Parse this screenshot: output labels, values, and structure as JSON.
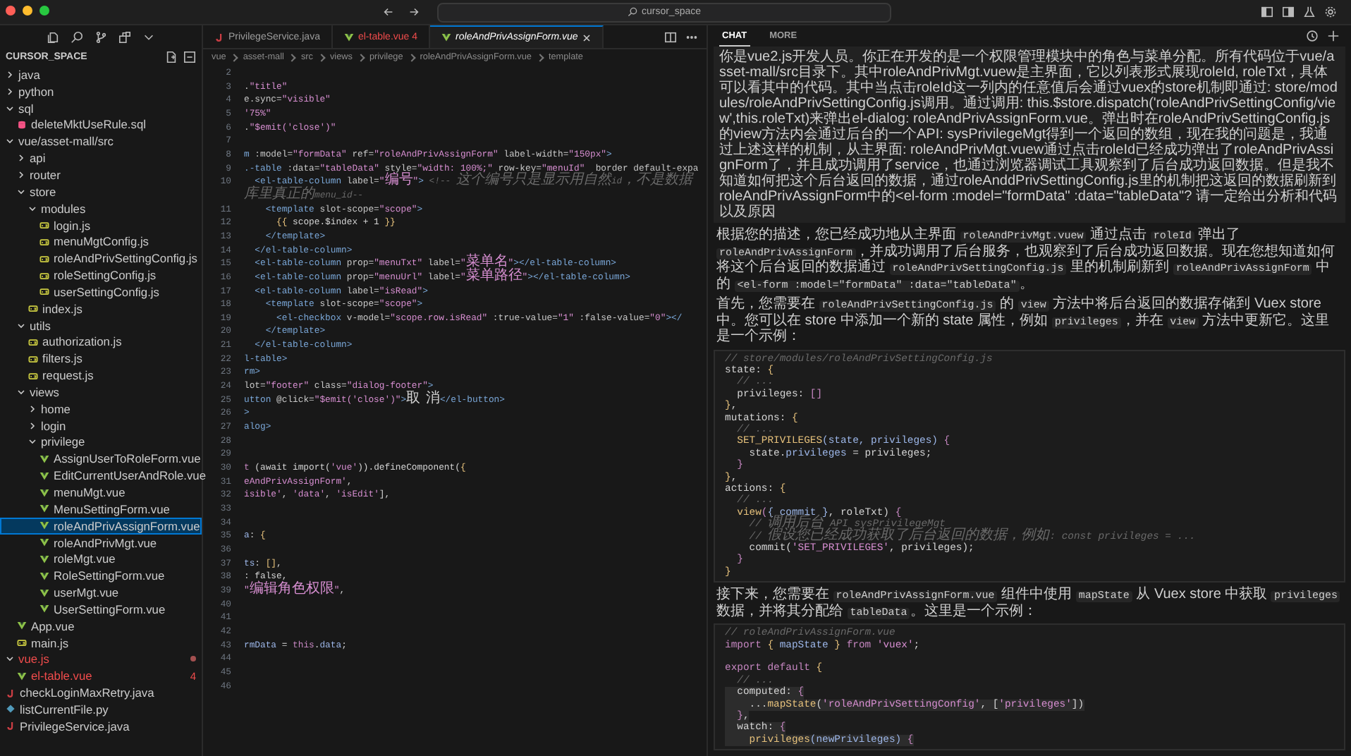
{
  "titlebar": {
    "search": "cursor_space"
  },
  "sidebar": {
    "title": "CURSOR_SPACE",
    "tree": [
      {
        "label": "java",
        "kind": "folder",
        "expanded": false,
        "selected": false,
        "error": false
      },
      {
        "label": "python",
        "kind": "folder",
        "expanded": false,
        "selected": false,
        "error": false
      },
      {
        "label": "sql",
        "kind": "folder",
        "expanded": true,
        "selected": false,
        "error": false,
        "children": [
          {
            "label": "deleteMktUseRule.sql",
            "kind": "sql",
            "selected": false,
            "error": false
          }
        ]
      },
      {
        "label": "vue/asset-mall/src",
        "kind": "folder",
        "expanded": true,
        "selected": false,
        "error": false,
        "children": [
          {
            "label": "api",
            "kind": "folder",
            "expanded": false,
            "selected": false,
            "error": false
          },
          {
            "label": "router",
            "kind": "folder",
            "expanded": false,
            "selected": false,
            "error": false
          },
          {
            "label": "store",
            "kind": "folder",
            "expanded": true,
            "selected": false,
            "error": false,
            "children": [
              {
                "label": "modules",
                "kind": "folder",
                "expanded": true,
                "selected": false,
                "error": false,
                "children": [
                  {
                    "label": "login.js",
                    "kind": "js",
                    "selected": false,
                    "error": false
                  },
                  {
                    "label": "menuMgtConfig.js",
                    "kind": "js",
                    "selected": false,
                    "error": false
                  },
                  {
                    "label": "roleAndPrivSettingConfig.js",
                    "kind": "js",
                    "selected": false,
                    "error": false
                  },
                  {
                    "label": "roleSettingConfig.js",
                    "kind": "js",
                    "selected": false,
                    "error": false
                  },
                  {
                    "label": "userSettingConfig.js",
                    "kind": "js",
                    "selected": false,
                    "error": false
                  }
                ]
              },
              {
                "label": "index.js",
                "kind": "js",
                "selected": false,
                "error": false
              }
            ]
          },
          {
            "label": "utils",
            "kind": "folder",
            "expanded": true,
            "selected": false,
            "error": false,
            "children": [
              {
                "label": "authorization.js",
                "kind": "js",
                "selected": false,
                "error": false
              },
              {
                "label": "filters.js",
                "kind": "js",
                "selected": false,
                "error": false
              },
              {
                "label": "request.js",
                "kind": "js",
                "selected": false,
                "error": false
              }
            ]
          },
          {
            "label": "views",
            "kind": "folder",
            "expanded": true,
            "selected": false,
            "error": false,
            "children": [
              {
                "label": "home",
                "kind": "folder",
                "expanded": false,
                "selected": false,
                "error": false
              },
              {
                "label": "login",
                "kind": "folder",
                "expanded": false,
                "selected": false,
                "error": false
              },
              {
                "label": "privilege",
                "kind": "folder",
                "expanded": true,
                "selected": false,
                "error": false,
                "children": [
                  {
                    "label": "AssignUserToRoleForm.vue",
                    "kind": "vue",
                    "selected": false,
                    "error": false
                  },
                  {
                    "label": "EditCurrentUserAndRole.vue",
                    "kind": "vue",
                    "selected": false,
                    "error": false
                  },
                  {
                    "label": "menuMgt.vue",
                    "kind": "vue",
                    "selected": false,
                    "error": false
                  },
                  {
                    "label": "MenuSettingForm.vue",
                    "kind": "vue",
                    "selected": false,
                    "error": false
                  },
                  {
                    "label": "roleAndPrivAssignForm.vue",
                    "kind": "vue",
                    "selected": true,
                    "error": false
                  },
                  {
                    "label": "roleAndPrivMgt.vue",
                    "kind": "vue",
                    "selected": false,
                    "error": false
                  },
                  {
                    "label": "roleMgt.vue",
                    "kind": "vue",
                    "selected": false,
                    "error": false
                  },
                  {
                    "label": "RoleSettingForm.vue",
                    "kind": "vue",
                    "selected": false,
                    "error": false
                  },
                  {
                    "label": "userMgt.vue",
                    "kind": "vue",
                    "selected": false,
                    "error": false
                  },
                  {
                    "label": "UserSettingForm.vue",
                    "kind": "vue",
                    "selected": false,
                    "error": false
                  }
                ]
              }
            ]
          },
          {
            "label": "App.vue",
            "kind": "vue",
            "selected": false,
            "error": false
          },
          {
            "label": "main.js",
            "kind": "js",
            "selected": false,
            "error": false
          }
        ]
      },
      {
        "label": "vue.js",
        "kind": "folder",
        "expanded": true,
        "selected": false,
        "error": true,
        "children": [
          {
            "label": "el-table.vue",
            "kind": "vue",
            "selected": false,
            "error": true,
            "badge": "4"
          }
        ]
      },
      {
        "label": "checkLoginMaxRetry.java",
        "kind": "java",
        "selected": false,
        "error": false
      },
      {
        "label": "listCurrentFile.py",
        "kind": "py",
        "selected": false,
        "error": false
      },
      {
        "label": "PrivilegeService.java",
        "kind": "java",
        "selected": false,
        "error": false
      }
    ]
  },
  "editor": {
    "tabs": [
      {
        "label": "PrivilegeService.java",
        "kind": "java",
        "selected": false,
        "error": false
      },
      {
        "label": "el-table.vue",
        "kind": "vue",
        "selected": false,
        "error": true,
        "badge": "4"
      },
      {
        "label": "roleAndPrivAssignForm.vue",
        "kind": "vue",
        "selected": true,
        "error": false
      }
    ],
    "breadcrumb": [
      "vue",
      "asset-mall",
      "src",
      "views",
      "privilege",
      "roleAndPrivAssignForm.vue",
      "template"
    ],
    "lines": [
      {
        "num": "2"
      },
      {
        "num": "3",
        "tokens": [
          {
            "kind": "plain",
            "text": "."
          },
          {
            "kind": "str",
            "text": "\"title\""
          }
        ]
      },
      {
        "num": "4",
        "tokens": [
          {
            "kind": "attr",
            "text": "e.sync="
          },
          {
            "kind": "str",
            "text": "\"visible\""
          }
        ]
      },
      {
        "num": "5",
        "tokens": [
          {
            "kind": "str",
            "text": "'75%\""
          }
        ]
      },
      {
        "num": "6",
        "tokens": [
          {
            "kind": "plain",
            "text": "."
          },
          {
            "kind": "str",
            "text": "\"$emit('close')\""
          }
        ]
      },
      {
        "num": "7"
      },
      {
        "num": "8",
        "tokens": [
          {
            "kind": "tag",
            "text": "m"
          },
          {
            "kind": "attr",
            "text": " :model="
          },
          {
            "kind": "str",
            "text": "\"formData\""
          },
          {
            "kind": "attr",
            "text": " ref="
          },
          {
            "kind": "str",
            "text": "\"roleAndPrivAssignForm\""
          },
          {
            "kind": "attr",
            "text": " label-width="
          },
          {
            "kind": "str",
            "text": "\"150px\""
          },
          {
            "kind": "tag",
            "text": ">"
          }
        ]
      },
      {
        "num": "9",
        "tokens": [
          {
            "kind": "tag",
            "text": ".-table"
          },
          {
            "kind": "attr",
            "text": " :data="
          },
          {
            "kind": "str",
            "text": "\"tableData\""
          },
          {
            "kind": "attr",
            "text": " style="
          },
          {
            "kind": "str",
            "text": "\"width: 100%;\""
          },
          {
            "kind": "attr",
            "text": " row-key="
          },
          {
            "kind": "str",
            "text": "\"menuId\""
          },
          {
            "kind": "attr",
            "text": "  border default-expa"
          }
        ]
      },
      {
        "num": "10",
        "tokens": [
          {
            "kind": "tag",
            "text": "  <el-table-column"
          },
          {
            "kind": "attr",
            "text": " label="
          },
          {
            "kind": "str",
            "text": "\"编号\""
          },
          {
            "kind": "tag",
            "text": ">"
          },
          {
            "kind": "cmt",
            "text": " <!-- 这个编号只是显示用自然id，不是数据库里真正的menu_id--"
          }
        ]
      },
      {
        "num": "11",
        "tokens": [
          {
            "kind": "tag",
            "text": "    <template"
          },
          {
            "kind": "attr",
            "text": " slot-scope="
          },
          {
            "kind": "str",
            "text": "\"scope\""
          },
          {
            "kind": "tag",
            "text": ">"
          }
        ]
      },
      {
        "num": "12",
        "tokens": [
          {
            "kind": "brace",
            "text": "      {{"
          },
          {
            "kind": "plain",
            "text": " scope.$index + 1 "
          },
          {
            "kind": "brace",
            "text": "}}"
          }
        ]
      },
      {
        "num": "13",
        "tokens": [
          {
            "kind": "tag",
            "text": "    </template>"
          }
        ]
      },
      {
        "num": "14",
        "tokens": [
          {
            "kind": "tag",
            "text": "  </el-table-column>"
          }
        ]
      },
      {
        "num": "15",
        "tokens": [
          {
            "kind": "tag",
            "text": "  <el-table-column"
          },
          {
            "kind": "attr",
            "text": " prop="
          },
          {
            "kind": "str",
            "text": "\"menuTxt\""
          },
          {
            "kind": "attr",
            "text": " label="
          },
          {
            "kind": "str",
            "text": "\"菜单名\""
          },
          {
            "kind": "tag",
            "text": "></el-table-column>"
          }
        ]
      },
      {
        "num": "16",
        "tokens": [
          {
            "kind": "tag",
            "text": "  <el-table-column"
          },
          {
            "kind": "attr",
            "text": " prop="
          },
          {
            "kind": "str",
            "text": "\"menuUrl\""
          },
          {
            "kind": "attr",
            "text": " label="
          },
          {
            "kind": "str",
            "text": "\"菜单路径\""
          },
          {
            "kind": "tag",
            "text": "></el-table-column>"
          }
        ]
      },
      {
        "num": "17",
        "tokens": [
          {
            "kind": "tag",
            "text": "  <el-table-column"
          },
          {
            "kind": "attr",
            "text": " label="
          },
          {
            "kind": "str",
            "text": "\"isRead\""
          },
          {
            "kind": "tag",
            "text": ">"
          }
        ]
      },
      {
        "num": "18",
        "tokens": [
          {
            "kind": "tag",
            "text": "    <template"
          },
          {
            "kind": "attr",
            "text": " slot-scope="
          },
          {
            "kind": "str",
            "text": "\"scope\""
          },
          {
            "kind": "tag",
            "text": ">"
          }
        ]
      },
      {
        "num": "19",
        "tokens": [
          {
            "kind": "tag",
            "text": "      <el-checkbox"
          },
          {
            "kind": "attr",
            "text": " v-model="
          },
          {
            "kind": "str",
            "text": "\"scope.row.isRead\""
          },
          {
            "kind": "attr",
            "text": " :true-value="
          },
          {
            "kind": "str",
            "text": "\"1\""
          },
          {
            "kind": "attr",
            "text": " :false-value="
          },
          {
            "kind": "str",
            "text": "\"0\""
          },
          {
            "kind": "tag",
            "text": "></"
          }
        ]
      },
      {
        "num": "20",
        "tokens": [
          {
            "kind": "tag",
            "text": "    </template>"
          }
        ]
      },
      {
        "num": "21",
        "tokens": [
          {
            "kind": "tag",
            "text": "  </el-table-column>"
          }
        ]
      },
      {
        "num": "22",
        "tokens": [
          {
            "kind": "tag",
            "text": "l-table>"
          }
        ]
      },
      {
        "num": "23",
        "tokens": [
          {
            "kind": "tag",
            "text": "rm>"
          }
        ]
      },
      {
        "num": "24",
        "tokens": [
          {
            "kind": "attr",
            "text": "lot="
          },
          {
            "kind": "str",
            "text": "\"footer\""
          },
          {
            "kind": "attr",
            "text": " class="
          },
          {
            "kind": "str",
            "text": "\"dialog-footer\""
          },
          {
            "kind": "tag",
            "text": ">"
          }
        ]
      },
      {
        "num": "25",
        "tokens": [
          {
            "kind": "tag",
            "text": "utton"
          },
          {
            "kind": "attr",
            "text": " @click="
          },
          {
            "kind": "str",
            "text": "\"$emit('close')\""
          },
          {
            "kind": "tag",
            "text": ">"
          },
          {
            "kind": "plain",
            "text": "取 消"
          },
          {
            "kind": "tag",
            "text": "</el-button>"
          }
        ]
      },
      {
        "num": "26",
        "tokens": [
          {
            "kind": "tag",
            "text": ">"
          }
        ]
      },
      {
        "num": "27",
        "tokens": [
          {
            "kind": "tag",
            "text": "alog>"
          }
        ]
      },
      {
        "num": "28"
      },
      {
        "num": "29"
      },
      {
        "num": "30",
        "tokens": [
          {
            "kind": "kw",
            "text": "t "
          },
          {
            "kind": "plain",
            "text": "(await import("
          },
          {
            "kind": "str",
            "text": "'vue'"
          },
          {
            "kind": "plain",
            "text": ")).defineComponent("
          },
          {
            "kind": "brace",
            "text": "{"
          }
        ]
      },
      {
        "num": "31",
        "tokens": [
          {
            "kind": "str",
            "text": "eAndPrivAssignForm'"
          },
          {
            "kind": "plain",
            "text": ","
          }
        ]
      },
      {
        "num": "32",
        "tokens": [
          {
            "kind": "str",
            "text": "isible'"
          },
          {
            "kind": "plain",
            "text": ", "
          },
          {
            "kind": "str",
            "text": "'data'"
          },
          {
            "kind": "plain",
            "text": ", "
          },
          {
            "kind": "str",
            "text": "'isEdit'"
          },
          {
            "kind": "plain",
            "text": "],"
          }
        ]
      },
      {
        "num": "33"
      },
      {
        "num": "34"
      },
      {
        "num": "35",
        "tokens": [
          {
            "kind": "var",
            "text": "a"
          },
          {
            "kind": "plain",
            "text": ": "
          },
          {
            "kind": "brace",
            "text": "{"
          }
        ]
      },
      {
        "num": "36"
      },
      {
        "num": "37",
        "tokens": [
          {
            "kind": "var",
            "text": "ts"
          },
          {
            "kind": "plain",
            "text": ": "
          },
          {
            "kind": "brace",
            "text": "[]"
          },
          {
            "kind": "plain",
            "text": ","
          }
        ]
      },
      {
        "num": "38",
        "tokens": [
          {
            "kind": "plain",
            "text": ": false,"
          }
        ]
      },
      {
        "num": "39",
        "tokens": [
          {
            "kind": "str",
            "text": "\"编辑角色权限\""
          },
          {
            "kind": "plain",
            "text": ","
          }
        ]
      },
      {
        "num": "40"
      },
      {
        "num": "41"
      },
      {
        "num": "42"
      },
      {
        "num": "43",
        "tokens": [
          {
            "kind": "var",
            "text": "rmData"
          },
          {
            "kind": "plain",
            "text": " = "
          },
          {
            "kind": "kw",
            "text": "this"
          },
          {
            "kind": "plain",
            "text": "."
          },
          {
            "kind": "var",
            "text": "data"
          },
          {
            "kind": "plain",
            "text": ";"
          }
        ]
      },
      {
        "num": "44"
      },
      {
        "num": "45"
      },
      {
        "num": "46"
      }
    ]
  },
  "chat": {
    "tabs": [
      {
        "label": "CHAT",
        "selected": true
      },
      {
        "label": "MORE",
        "selected": false
      }
    ],
    "user_message": "你是vue2.js开发人员。你正在开发的是一个权限管理模块中的角色与菜单分配。所有代码位于vue/asset-mall/src目录下。其中roleAndPrivMgt.vuew是主界面，它以列表形式展现roleId, roleTxt，具体可以看其中的代码。其中当点击roleId这一列内的任意值后会通过vuex的store机制即通过: store/modules/roleAndPrivSettingConfig.js调用。通过调用: this.$store.dispatch('roleAndPrivSettingConfig/view',this.roleTxt)来弹出el-dialog: roleAndPrivAssignForm.vue。弹出时在roleAndPrivSettingConfig.js的view方法内会通过后台的一个API: sysPrivilegeMgt得到一个返回的数组，现在我的问题是，我通过上述这样的机制，从主界面: roleAndPrivMgt.vuew通过点击roleId已经成功弹出了roleAndPrivAssignForm了，并且成功调用了service，也通过浏览器调试工具观察到了后台成功返回数据。但是我不知道如何把这个后台返回的数据，通过roleAnddPrivSettingConfig.js里的机制把这返回的数据刷新到roleAndPrivAssignForm中的<el-form :model=\"formData\" :data=\"tableData\"? 请一定给出分析和代码以及原因",
    "reply": [
      {
        "kind": "paragraph",
        "segments": [
          {
            "kind": "text",
            "text": "根据您的描述，您已经成功地从主界面 "
          },
          {
            "kind": "code",
            "text": "roleAndPrivMgt.vuew"
          },
          {
            "kind": "text",
            "text": " 通过点击 "
          },
          {
            "kind": "code",
            "text": "roleId"
          },
          {
            "kind": "text",
            "text": " 弹出了 "
          },
          {
            "kind": "code",
            "text": "roleAndPrivAssignForm"
          },
          {
            "kind": "text",
            "text": "，并成功调用了后台服务，也观察到了后台成功返回数据。现在您想知道如何将这个后台返回的数据通过 "
          },
          {
            "kind": "code",
            "text": "roleAndPrivSettingConfig.js"
          },
          {
            "kind": "text",
            "text": " 里的机制刷新到 "
          },
          {
            "kind": "code",
            "text": "roleAndPrivAssignForm"
          },
          {
            "kind": "text",
            "text": " 中的 "
          },
          {
            "kind": "code",
            "text": "<el-form :model=\"formData\" :data=\"tableData\""
          },
          {
            "kind": "text",
            "text": "。"
          }
        ]
      },
      {
        "kind": "paragraph",
        "segments": [
          {
            "kind": "text",
            "text": "首先，您需要在 "
          },
          {
            "kind": "code",
            "text": "roleAndPrivSettingConfig.js"
          },
          {
            "kind": "text",
            "text": " 的 "
          },
          {
            "kind": "code",
            "text": "view"
          },
          {
            "kind": "text",
            "text": " 方法中将后台返回的数据存储到 Vuex store 中。您可以在 store 中添加一个新的 state 属性，例如 "
          },
          {
            "kind": "code",
            "text": "privileges"
          },
          {
            "kind": "text",
            "text": "，并在 "
          },
          {
            "kind": "code",
            "text": "view"
          },
          {
            "kind": "text",
            "text": " 方法中更新它。这里是一个示例："
          }
        ]
      },
      {
        "kind": "code",
        "lines": [
          {
            "highlighted": false,
            "tokens": [
              {
                "kind": "cmt",
                "text": "// store/modules/roleAndPrivSettingConfig.js"
              }
            ]
          },
          {
            "highlighted": false,
            "tokens": [
              {
                "kind": "plain",
                "text": "state: "
              },
              {
                "kind": "brace",
                "text": "{"
              }
            ]
          },
          {
            "highlighted": false,
            "tokens": [
              {
                "kind": "cmt",
                "text": "  // ..."
              }
            ]
          },
          {
            "highlighted": false,
            "tokens": [
              {
                "kind": "plain",
                "text": "  privileges: "
              },
              {
                "kind": "kw",
                "text": "[]"
              }
            ]
          },
          {
            "highlighted": false,
            "tokens": [
              {
                "kind": "brace",
                "text": "}"
              },
              {
                "kind": "plain",
                "text": ","
              }
            ]
          },
          {
            "highlighted": false,
            "tokens": [
              {
                "kind": "plain",
                "text": "mutations: "
              },
              {
                "kind": "brace",
                "text": "{"
              }
            ]
          },
          {
            "highlighted": false,
            "tokens": [
              {
                "kind": "cmt",
                "text": "  // ..."
              }
            ]
          },
          {
            "highlighted": false,
            "tokens": [
              {
                "kind": "fn",
                "text": "  SET_PRIVILEGES"
              },
              {
                "kind": "var",
                "text": "(state, privileges) "
              },
              {
                "kind": "kw",
                "text": "{"
              }
            ]
          },
          {
            "highlighted": false,
            "tokens": [
              {
                "kind": "plain",
                "text": "    state."
              },
              {
                "kind": "var",
                "text": "privileges"
              },
              {
                "kind": "plain",
                "text": " = privileges;"
              }
            ]
          },
          {
            "highlighted": false,
            "tokens": [
              {
                "kind": "kw",
                "text": "  }"
              }
            ]
          },
          {
            "highlighted": false,
            "tokens": [
              {
                "kind": "brace",
                "text": "}"
              },
              {
                "kind": "plain",
                "text": ","
              }
            ]
          },
          {
            "highlighted": false,
            "tokens": [
              {
                "kind": "plain",
                "text": "actions: "
              },
              {
                "kind": "brace",
                "text": "{"
              }
            ]
          },
          {
            "highlighted": false,
            "tokens": [
              {
                "kind": "cmt",
                "text": "  // ..."
              }
            ]
          },
          {
            "highlighted": false,
            "tokens": [
              {
                "kind": "fn",
                "text": "  view"
              },
              {
                "kind": "kw",
                "text": "("
              },
              {
                "kind": "var",
                "text": "{ commit }"
              },
              {
                "kind": "plain",
                "text": ", roleTxt) "
              },
              {
                "kind": "kw",
                "text": "{"
              }
            ]
          },
          {
            "highlighted": false,
            "tokens": [
              {
                "kind": "cmt",
                "text": "    // 调用后台 API sysPrivilegeMgt"
              }
            ]
          },
          {
            "highlighted": false,
            "tokens": [
              {
                "kind": "cmt",
                "text": "    // 假设您已经成功获取了后台返回的数据，例如: const privileges = ..."
              }
            ]
          },
          {
            "highlighted": false,
            "tokens": [
              {
                "kind": "plain",
                "text": "    commit("
              },
              {
                "kind": "str",
                "text": "'SET_PRIVILEGES'"
              },
              {
                "kind": "plain",
                "text": ", privileges);"
              }
            ]
          },
          {
            "highlighted": false,
            "tokens": [
              {
                "kind": "kw",
                "text": "  }"
              }
            ]
          },
          {
            "highlighted": false,
            "tokens": [
              {
                "kind": "brace",
                "text": "}"
              }
            ]
          }
        ]
      },
      {
        "kind": "paragraph",
        "segments": [
          {
            "kind": "text",
            "text": "接下来，您需要在 "
          },
          {
            "kind": "code",
            "text": "roleAndPrivAssignForm.vue"
          },
          {
            "kind": "text",
            "text": " 组件中使用 "
          },
          {
            "kind": "code",
            "text": "mapState"
          },
          {
            "kind": "text",
            "text": " 从 Vuex store 中获取 "
          },
          {
            "kind": "code",
            "text": "privileges"
          },
          {
            "kind": "text",
            "text": " 数据，并将其分配给 "
          },
          {
            "kind": "code",
            "text": "tableData"
          },
          {
            "kind": "text",
            "text": "。这里是一个示例："
          }
        ]
      },
      {
        "kind": "code",
        "lines": [
          {
            "highlighted": false,
            "tokens": [
              {
                "kind": "cmt",
                "text": "// roleAndPrivAssignForm.vue"
              }
            ]
          },
          {
            "highlighted": false,
            "tokens": [
              {
                "kind": "kw",
                "text": "import "
              },
              {
                "kind": "brace",
                "text": "{"
              },
              {
                "kind": "var",
                "text": " mapState "
              },
              {
                "kind": "brace",
                "text": "} "
              },
              {
                "kind": "kw",
                "text": "from "
              },
              {
                "kind": "str",
                "text": "'vuex'"
              },
              {
                "kind": "plain",
                "text": ";"
              }
            ]
          },
          {
            "highlighted": false
          },
          {
            "highlighted": false,
            "tokens": [
              {
                "kind": "kw",
                "text": "export default "
              },
              {
                "kind": "brace",
                "text": "{"
              }
            ]
          },
          {
            "highlighted": false,
            "tokens": [
              {
                "kind": "cmt",
                "text": "  // ..."
              }
            ]
          },
          {
            "highlighted": true,
            "tokens": [
              {
                "kind": "plain",
                "text": "  computed: "
              },
              {
                "kind": "kw",
                "text": "{"
              }
            ]
          },
          {
            "highlighted": true,
            "tokens": [
              {
                "kind": "plain",
                "text": "    ..."
              },
              {
                "kind": "fn",
                "text": "mapState"
              },
              {
                "kind": "plain",
                "text": "("
              },
              {
                "kind": "str",
                "text": "'roleAndPrivSettingConfig'"
              },
              {
                "kind": "plain",
                "text": ", ["
              },
              {
                "kind": "str",
                "text": "'privileges'"
              },
              {
                "kind": "plain",
                "text": "])"
              }
            ]
          },
          {
            "highlighted": true,
            "tokens": [
              {
                "kind": "kw",
                "text": "  }"
              },
              {
                "kind": "plain",
                "text": ","
              }
            ]
          },
          {
            "highlighted": true,
            "tokens": [
              {
                "kind": "plain",
                "text": "  watch: "
              },
              {
                "kind": "kw",
                "text": "{"
              }
            ]
          },
          {
            "highlighted": true,
            "tokens": [
              {
                "kind": "fn",
                "text": "    privileges"
              },
              {
                "kind": "var",
                "text": "(newPrivileges) "
              },
              {
                "kind": "kw",
                "text": "{"
              }
            ]
          }
        ]
      }
    ]
  }
}
